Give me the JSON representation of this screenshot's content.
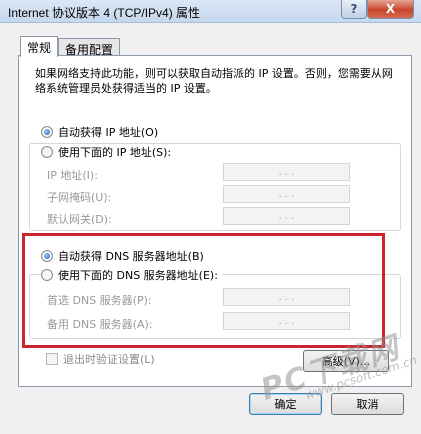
{
  "window": {
    "title": "Internet 协议版本 4 (TCP/IPv4) 属性",
    "help_glyph": "?",
    "close_glyph": "X"
  },
  "tabs": [
    {
      "label": "常规",
      "active": true
    },
    {
      "label": "备用配置",
      "active": false
    }
  ],
  "intro_text": "如果网络支持此功能，则可以获取自动指派的 IP 设置。否则，您需要从网络系统管理员处获得适当的 IP 设置。",
  "ip_section": {
    "auto_label": "自动获得 IP 地址(O)",
    "auto_selected": true,
    "manual_label": "使用下面的 IP 地址(S):",
    "fields": [
      {
        "label": "IP 地址(I):",
        "value": ".    .    ."
      },
      {
        "label": "子网掩码(U):",
        "value": ".    .    ."
      },
      {
        "label": "默认网关(D):",
        "value": ".    .    ."
      }
    ]
  },
  "dns_section": {
    "auto_label": "自动获得 DNS 服务器地址(B)",
    "auto_selected": true,
    "manual_label": "使用下面的 DNS 服务器地址(E):",
    "fields": [
      {
        "label": "首选 DNS 服务器(P):",
        "value": ".    .    ."
      },
      {
        "label": "备用 DNS 服务器(A):",
        "value": ".    .    ."
      }
    ]
  },
  "validate_label": "退出时验证设置(L)",
  "buttons": {
    "advanced": "高级(V)...",
    "ok": "确定",
    "cancel": "取消"
  },
  "watermark": {
    "main": "PC下载网",
    "url": "www.pcsoft.com.cn"
  },
  "colors": {
    "highlight_border": "#c9262d",
    "close_button": "#c7452c"
  }
}
